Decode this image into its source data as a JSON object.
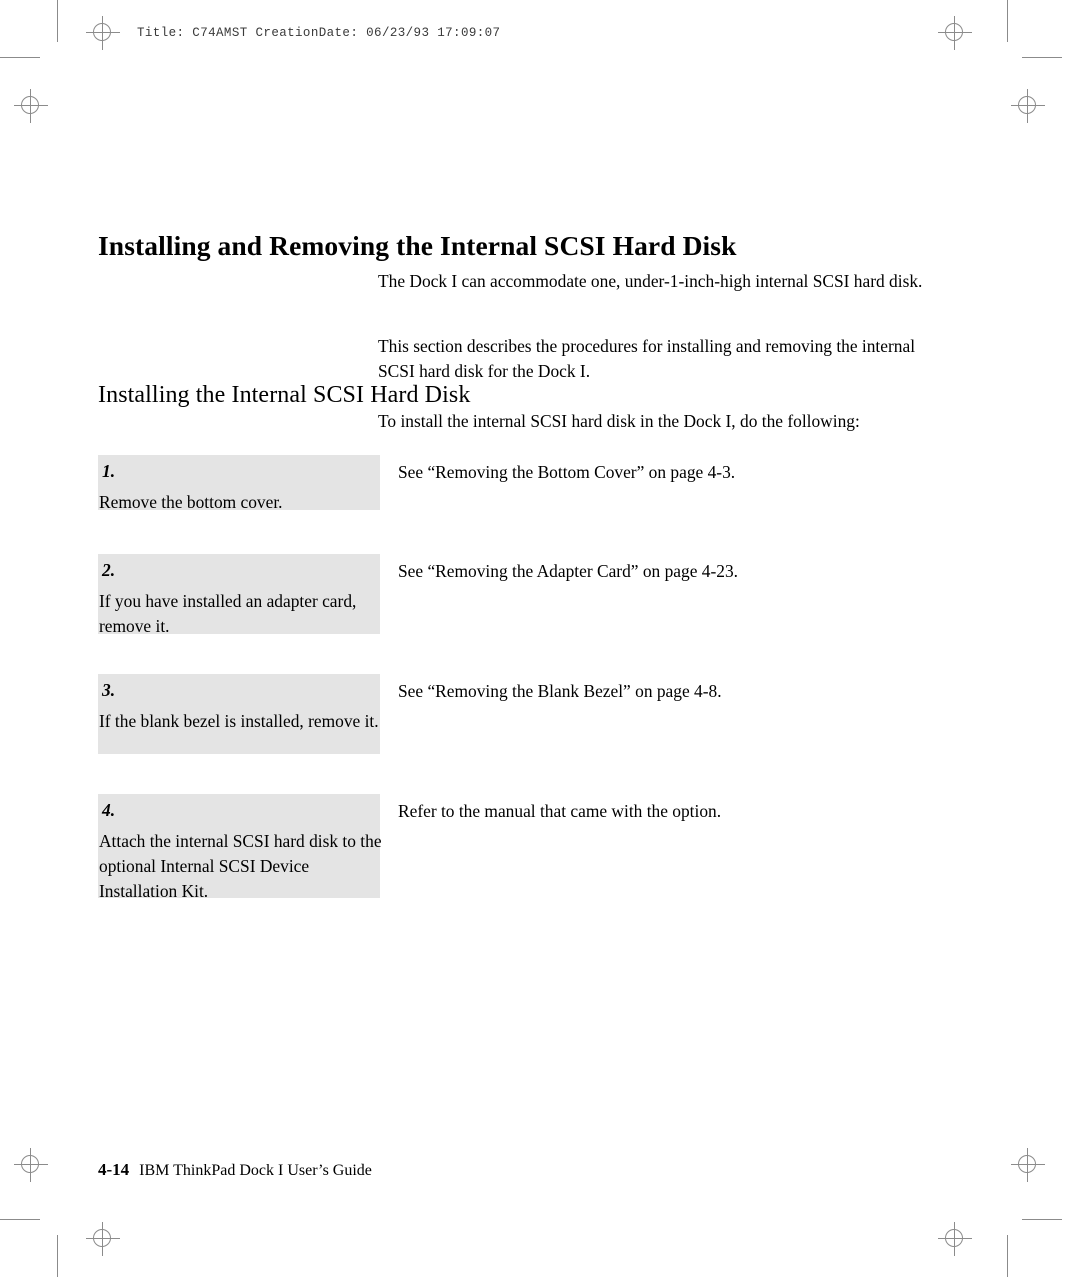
{
  "page_header": "Title: C74AMST CreationDate: 06/23/93 17:09:07",
  "headings": {
    "title": "Installing and Removing the Internal SCSI Hard Disk",
    "subtitle": "Installing the Internal SCSI Hard Disk"
  },
  "paragraphs": {
    "intro_1": "The Dock I can accommodate one, under-1-inch-high internal SCSI hard disk.",
    "intro_2": "This section describes the procedures for installing and removing the internal SCSI hard disk for the Dock I.",
    "intro_3": "To install the internal SCSI hard disk in the Dock I, do the following:"
  },
  "steps": [
    {
      "number": "1.",
      "action": "Remove the bottom cover.",
      "result": "See “Removing the Bottom Cover” on page  4-3."
    },
    {
      "number": "2.",
      "action": "If you have installed an adapter card, remove it.",
      "result": "See “Removing the Adapter Card” on page  4-23."
    },
    {
      "number": "3.",
      "action": "If the blank bezel is installed, remove it.",
      "result": "See “Removing the Blank Bezel” on page  4-8."
    },
    {
      "number": "4.",
      "action": "Attach the internal SCSI hard disk to the optional Internal SCSI Device Installation Kit.",
      "result": "Refer to the manual that came with the option."
    }
  ],
  "footer": {
    "page_number": "4-14",
    "book_title": "IBM ThinkPad Dock I User’s Guide"
  },
  "colors": {
    "step_box_fill": "#e4e4e4",
    "crop_mark": "#8b8b8b",
    "text": "#000000"
  }
}
